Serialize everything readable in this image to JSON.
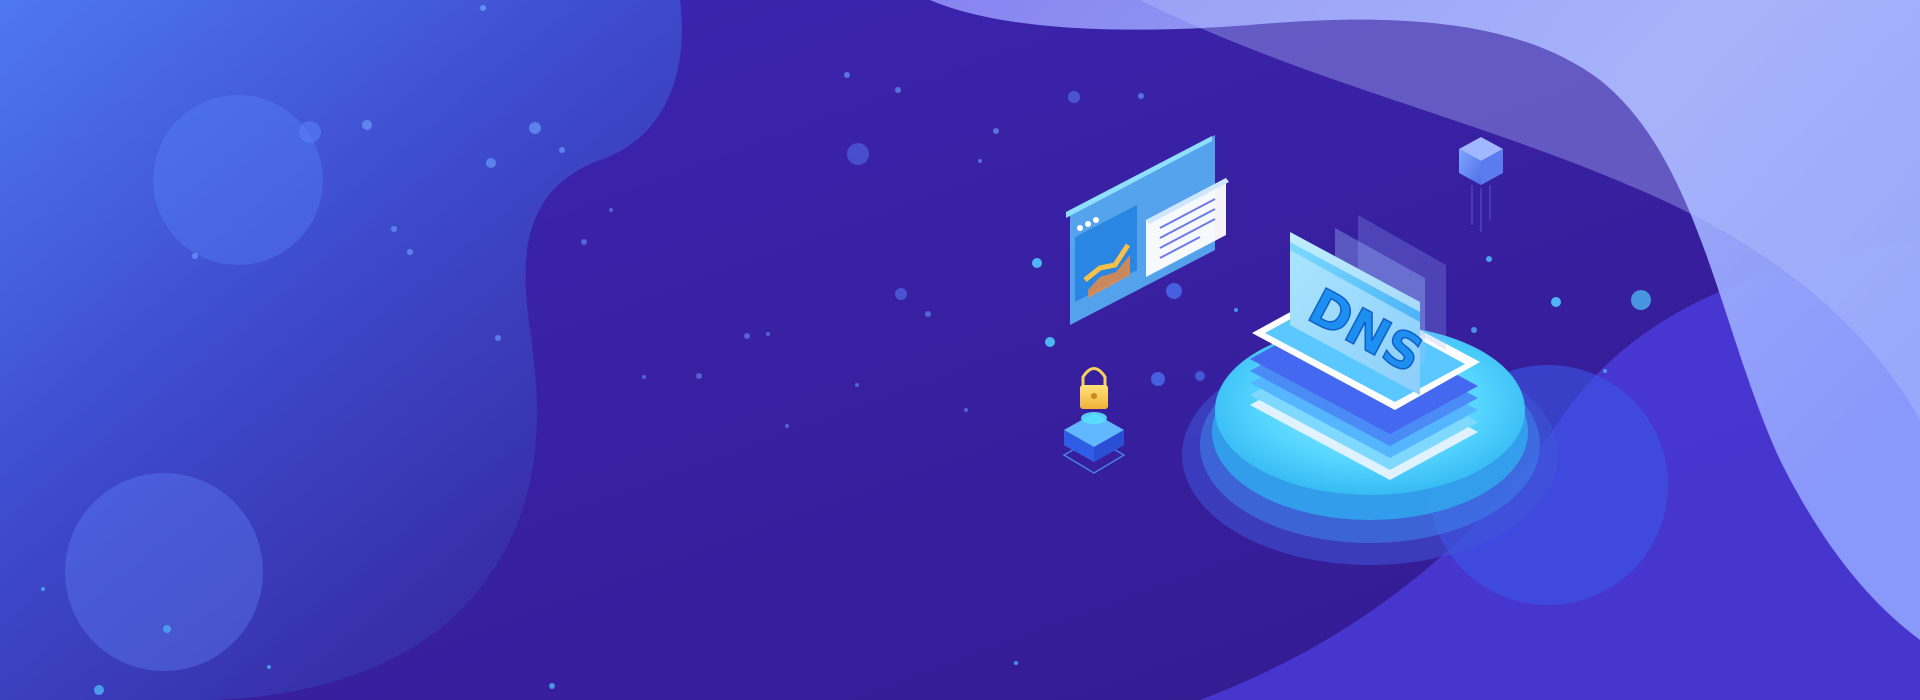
{
  "scene": {
    "badge_text": "DNS",
    "colors": {
      "background_deep": "#341b96",
      "background_mid": "#3b22aa",
      "left_blob": "#4a6cf0",
      "right_wave_light": "#a9b8ff",
      "right_wave_mid": "#7f7cf2",
      "platform_cyan": "#39c8f5",
      "platform_light": "#8ee6ff",
      "screen_blue": "#5dd3ff",
      "lock_yellow": "#f7d25a"
    },
    "icons": [
      "dns-server-platform",
      "browser-window-icon",
      "document-card-icon",
      "padlock-icon",
      "floating-cube-icon"
    ]
  }
}
